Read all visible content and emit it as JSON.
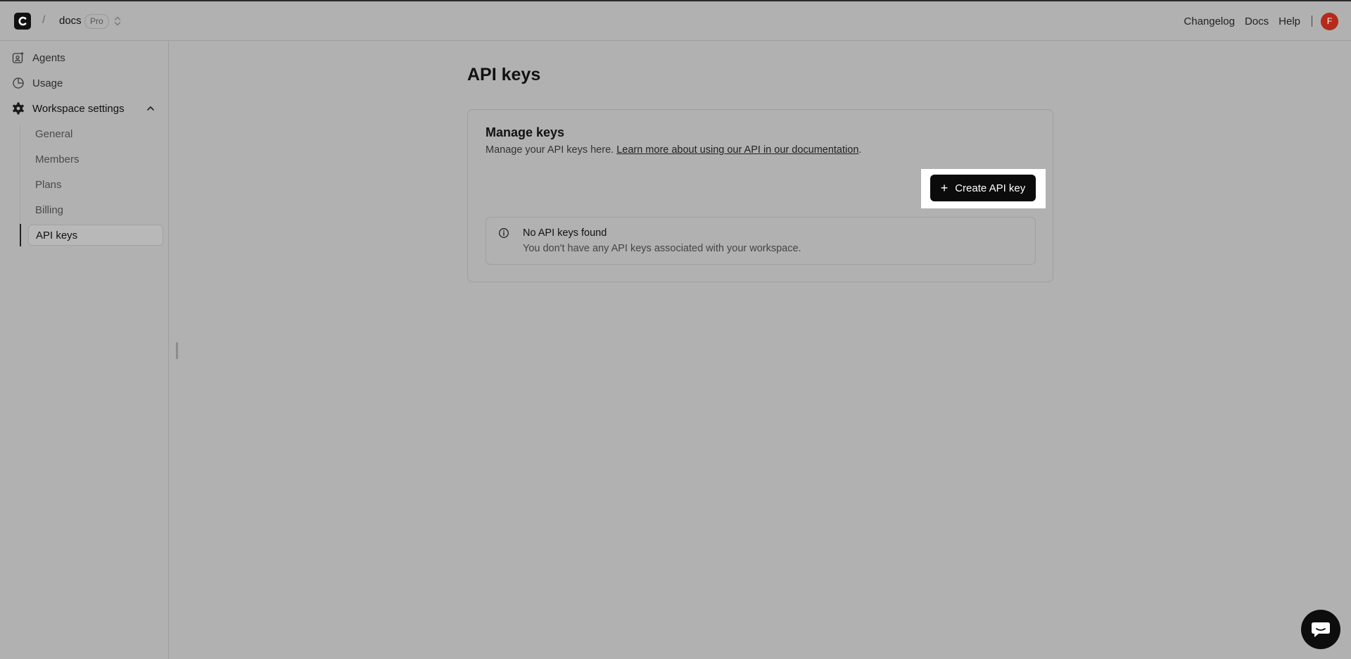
{
  "header": {
    "logo_letter": "C",
    "separator": "/",
    "workspace": "docs",
    "plan_badge": "Pro",
    "links": {
      "changelog": "Changelog",
      "docs": "Docs",
      "help": "Help"
    },
    "avatar_initial": "F",
    "avatar_color": "#b52a1a"
  },
  "sidebar": {
    "agents": "Agents",
    "usage": "Usage",
    "workspace_settings": "Workspace settings",
    "sub_items": [
      "General",
      "Members",
      "Plans",
      "Billing",
      "API keys"
    ],
    "active_item": "API keys"
  },
  "main": {
    "title": "API keys",
    "card": {
      "title": "Manage keys",
      "desc_prefix": "Manage your API keys here. ",
      "desc_link": "Learn more about using our API in our documentation",
      "desc_suffix": ".",
      "create_button": "Create API key",
      "empty_title": "No API keys found",
      "empty_desc": "You don't have any API keys associated with your workspace."
    }
  },
  "colors": {
    "overlay": "#b1b1b1",
    "button": "#0b0b0b",
    "highlight": "#ffffff"
  }
}
